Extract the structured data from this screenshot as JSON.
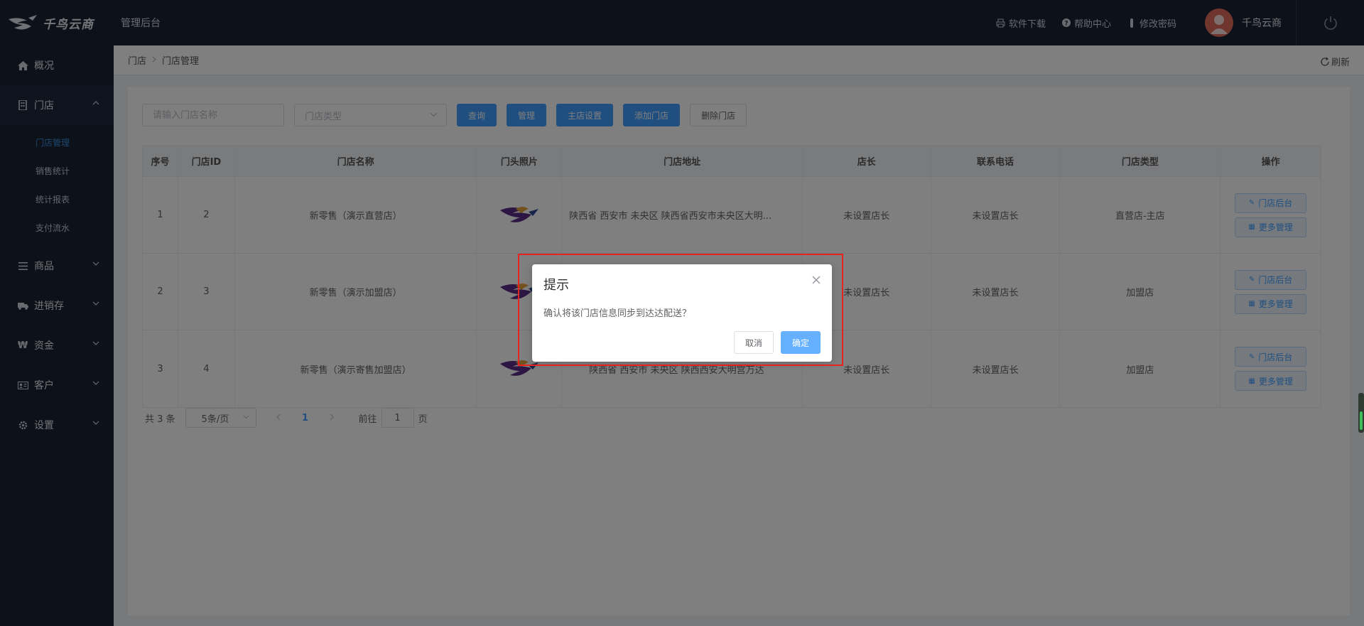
{
  "app": {
    "logo_text": "千鸟云商",
    "title": "管理后台"
  },
  "header": {
    "links": [
      {
        "label": "软件下载",
        "icon": "printer-icon"
      },
      {
        "label": "帮助中心",
        "icon": "help-icon"
      },
      {
        "label": "修改密码",
        "icon": "key-icon"
      }
    ],
    "user_name": "千鸟云商"
  },
  "sidebar": {
    "items": [
      {
        "label": "概况",
        "icon": "home-icon"
      },
      {
        "label": "门店",
        "icon": "building-icon",
        "open": true,
        "children": [
          {
            "label": "门店管理",
            "active": true
          },
          {
            "label": "销售统计"
          },
          {
            "label": "统计报表"
          },
          {
            "label": "支付流水"
          }
        ]
      },
      {
        "label": "商品",
        "icon": "list-icon"
      },
      {
        "label": "进销存",
        "icon": "truck-icon"
      },
      {
        "label": "资金",
        "icon": "won-icon"
      },
      {
        "label": "客户",
        "icon": "id-card-icon"
      },
      {
        "label": "设置",
        "icon": "gear-icon"
      }
    ]
  },
  "breadcrumb": {
    "items": [
      "门店",
      "门店管理"
    ],
    "refresh_label": "刷新"
  },
  "filters": {
    "name_placeholder": "请输入门店名称",
    "type_placeholder": "门店类型",
    "buttons": {
      "query": "查询",
      "manage": "管理",
      "main_store": "主店设置",
      "add": "添加门店",
      "delete": "删除门店"
    }
  },
  "table": {
    "columns": [
      "序号",
      "门店ID",
      "门店名称",
      "门头照片",
      "门店地址",
      "店长",
      "联系电话",
      "门店类型",
      "操作"
    ],
    "rows": [
      {
        "idx": "1",
        "id": "2",
        "name": "新零售（演示直营店）",
        "address": "陕西省 西安市 未央区 陕西省西安市未央区大明...",
        "manager": "未设置店长",
        "phone": "未设置店长",
        "type": "直营店-主店"
      },
      {
        "idx": "2",
        "id": "3",
        "name": "新零售（演示加盟店）",
        "address": "",
        "manager": "未设置店长",
        "phone": "未设置店长",
        "type": "加盟店"
      },
      {
        "idx": "3",
        "id": "4",
        "name": "新零售（演示寄售加盟店）",
        "address": "陕西省 西安市 未央区 陕西西安大明宫万达",
        "manager": "未设置店长",
        "phone": "未设置店长",
        "type": "加盟店"
      }
    ],
    "actions": {
      "backend": "门店后台",
      "more": "更多管理"
    }
  },
  "pagination": {
    "total": "共 3 条",
    "page_size": "5条/页",
    "current_page": "1",
    "goto_prefix": "前往",
    "goto_value": "1",
    "goto_suffix": "页"
  },
  "dialog": {
    "title": "提示",
    "message": "确认将该门店信息同步到达达配送？",
    "cancel": "取消",
    "confirm": "确定"
  },
  "colors": {
    "header_bg": "#1a2233",
    "primary": "#409eff",
    "highlight": "#e5241f",
    "active_menu": "#3d8fe0"
  }
}
